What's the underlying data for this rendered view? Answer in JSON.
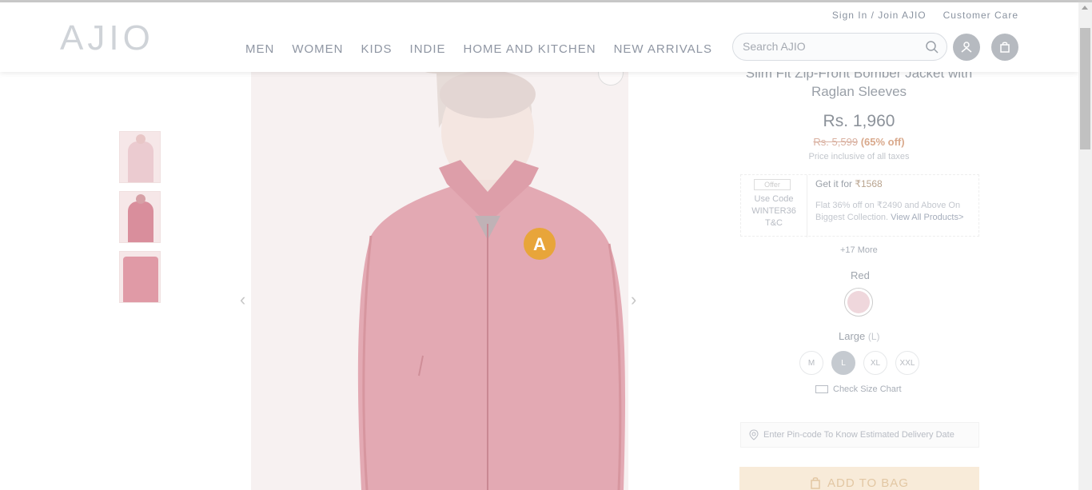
{
  "header": {
    "logo": "AJIO",
    "top_links": [
      "Sign In / Join AJIO",
      "Customer Care"
    ],
    "nav": [
      "MEN",
      "WOMEN",
      "KIDS",
      "INDIE",
      "HOME AND KITCHEN",
      "NEW ARRIVALS"
    ],
    "search_placeholder": "Search AJIO"
  },
  "gallery": {
    "thumbnails": 3,
    "prev_arrow": "‹",
    "next_arrow": "›",
    "badge_letter": "A"
  },
  "product": {
    "title": "Slim Fit Zip-Front Bomber Jacket with Raglan Sleeves",
    "price": "Rs. 1,960",
    "mrp": "Rs. 5,599",
    "discount": "(65% off)",
    "tax_note": "Price inclusive of all taxes",
    "offer": {
      "tag": "Offer",
      "use_code": "Use Code",
      "code": "WINTER36",
      "tnc": "T&C",
      "get_it_for": "Get it for",
      "get_price": "₹1568",
      "desc": "Flat 36% off on ₹2490 and Above On Biggest Collection.",
      "link": "View All Products>"
    },
    "more_offers": "+17 More",
    "color": "Red",
    "size_label": "Large",
    "size_code": "(L)",
    "sizes": [
      "M",
      "L",
      "XL",
      "XXL"
    ],
    "selected_size": "L",
    "size_chart": "Check Size Chart",
    "pincode_placeholder": "Enter Pin-code To Know Estimated Delivery Date",
    "add_to_bag": "ADD TO BAG"
  },
  "colors": {
    "jacket": "#e3a9b3",
    "swatch": "#efd7dc",
    "badge": "#e8a53a"
  }
}
